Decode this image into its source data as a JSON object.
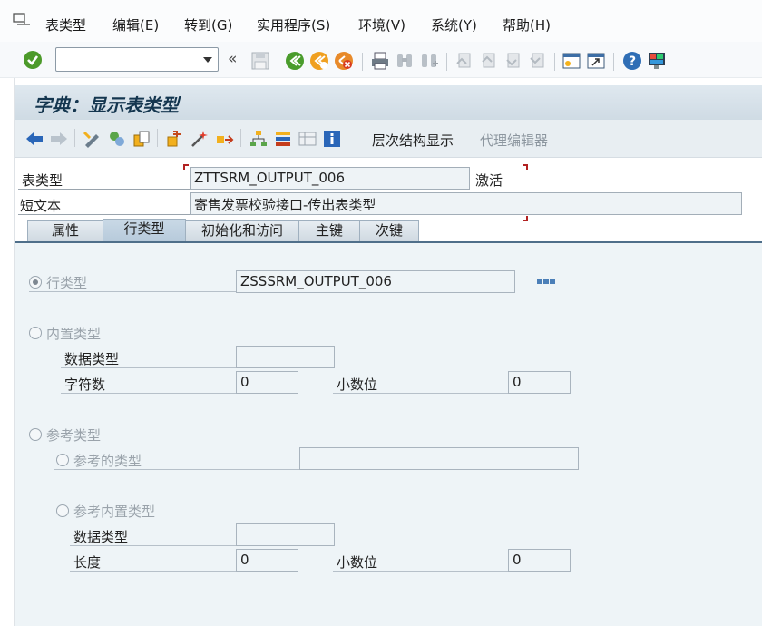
{
  "menubar": {
    "items": [
      "表类型",
      "编辑(E)",
      "转到(G)",
      "实用程序(S)",
      "环境(V)",
      "系统(Y)",
      "帮助(H)"
    ]
  },
  "toolbar": {
    "command_value": "",
    "back_label": "«"
  },
  "title": "字典：显示表类型",
  "app_toolbar": {
    "hierarchy_label": "层次结构显示",
    "proxy_editor_label": "代理编辑器"
  },
  "header": {
    "table_type_label": "表类型",
    "table_type_value": "ZTTSRM_OUTPUT_006",
    "status": "激活",
    "short_text_label": "短文本",
    "short_text_value": "寄售发票校验接口-传出表类型"
  },
  "tabs": [
    "属性",
    "行类型",
    "初始化和访问",
    "主键",
    "次键"
  ],
  "active_tab": "行类型",
  "line_type": {
    "row_type_label": "行类型",
    "row_type_value": "ZSSSRM_OUTPUT_006",
    "builtin_label": "内置类型",
    "data_type_label": "数据类型",
    "data_type_value": "",
    "chars_label": "字符数",
    "chars_value": "0",
    "decimals_label": "小数位",
    "decimals_value": "0",
    "ref_type_label": "参考类型",
    "ref_to_type_label": "参考的类型",
    "ref_to_type_value": "",
    "ref_builtin_label": "参考内置类型",
    "ref_data_type_label": "数据类型",
    "ref_data_type_value": "",
    "length_label": "长度",
    "length_value": "0",
    "ref_decimals_label": "小数位",
    "ref_decimals_value": "0"
  }
}
